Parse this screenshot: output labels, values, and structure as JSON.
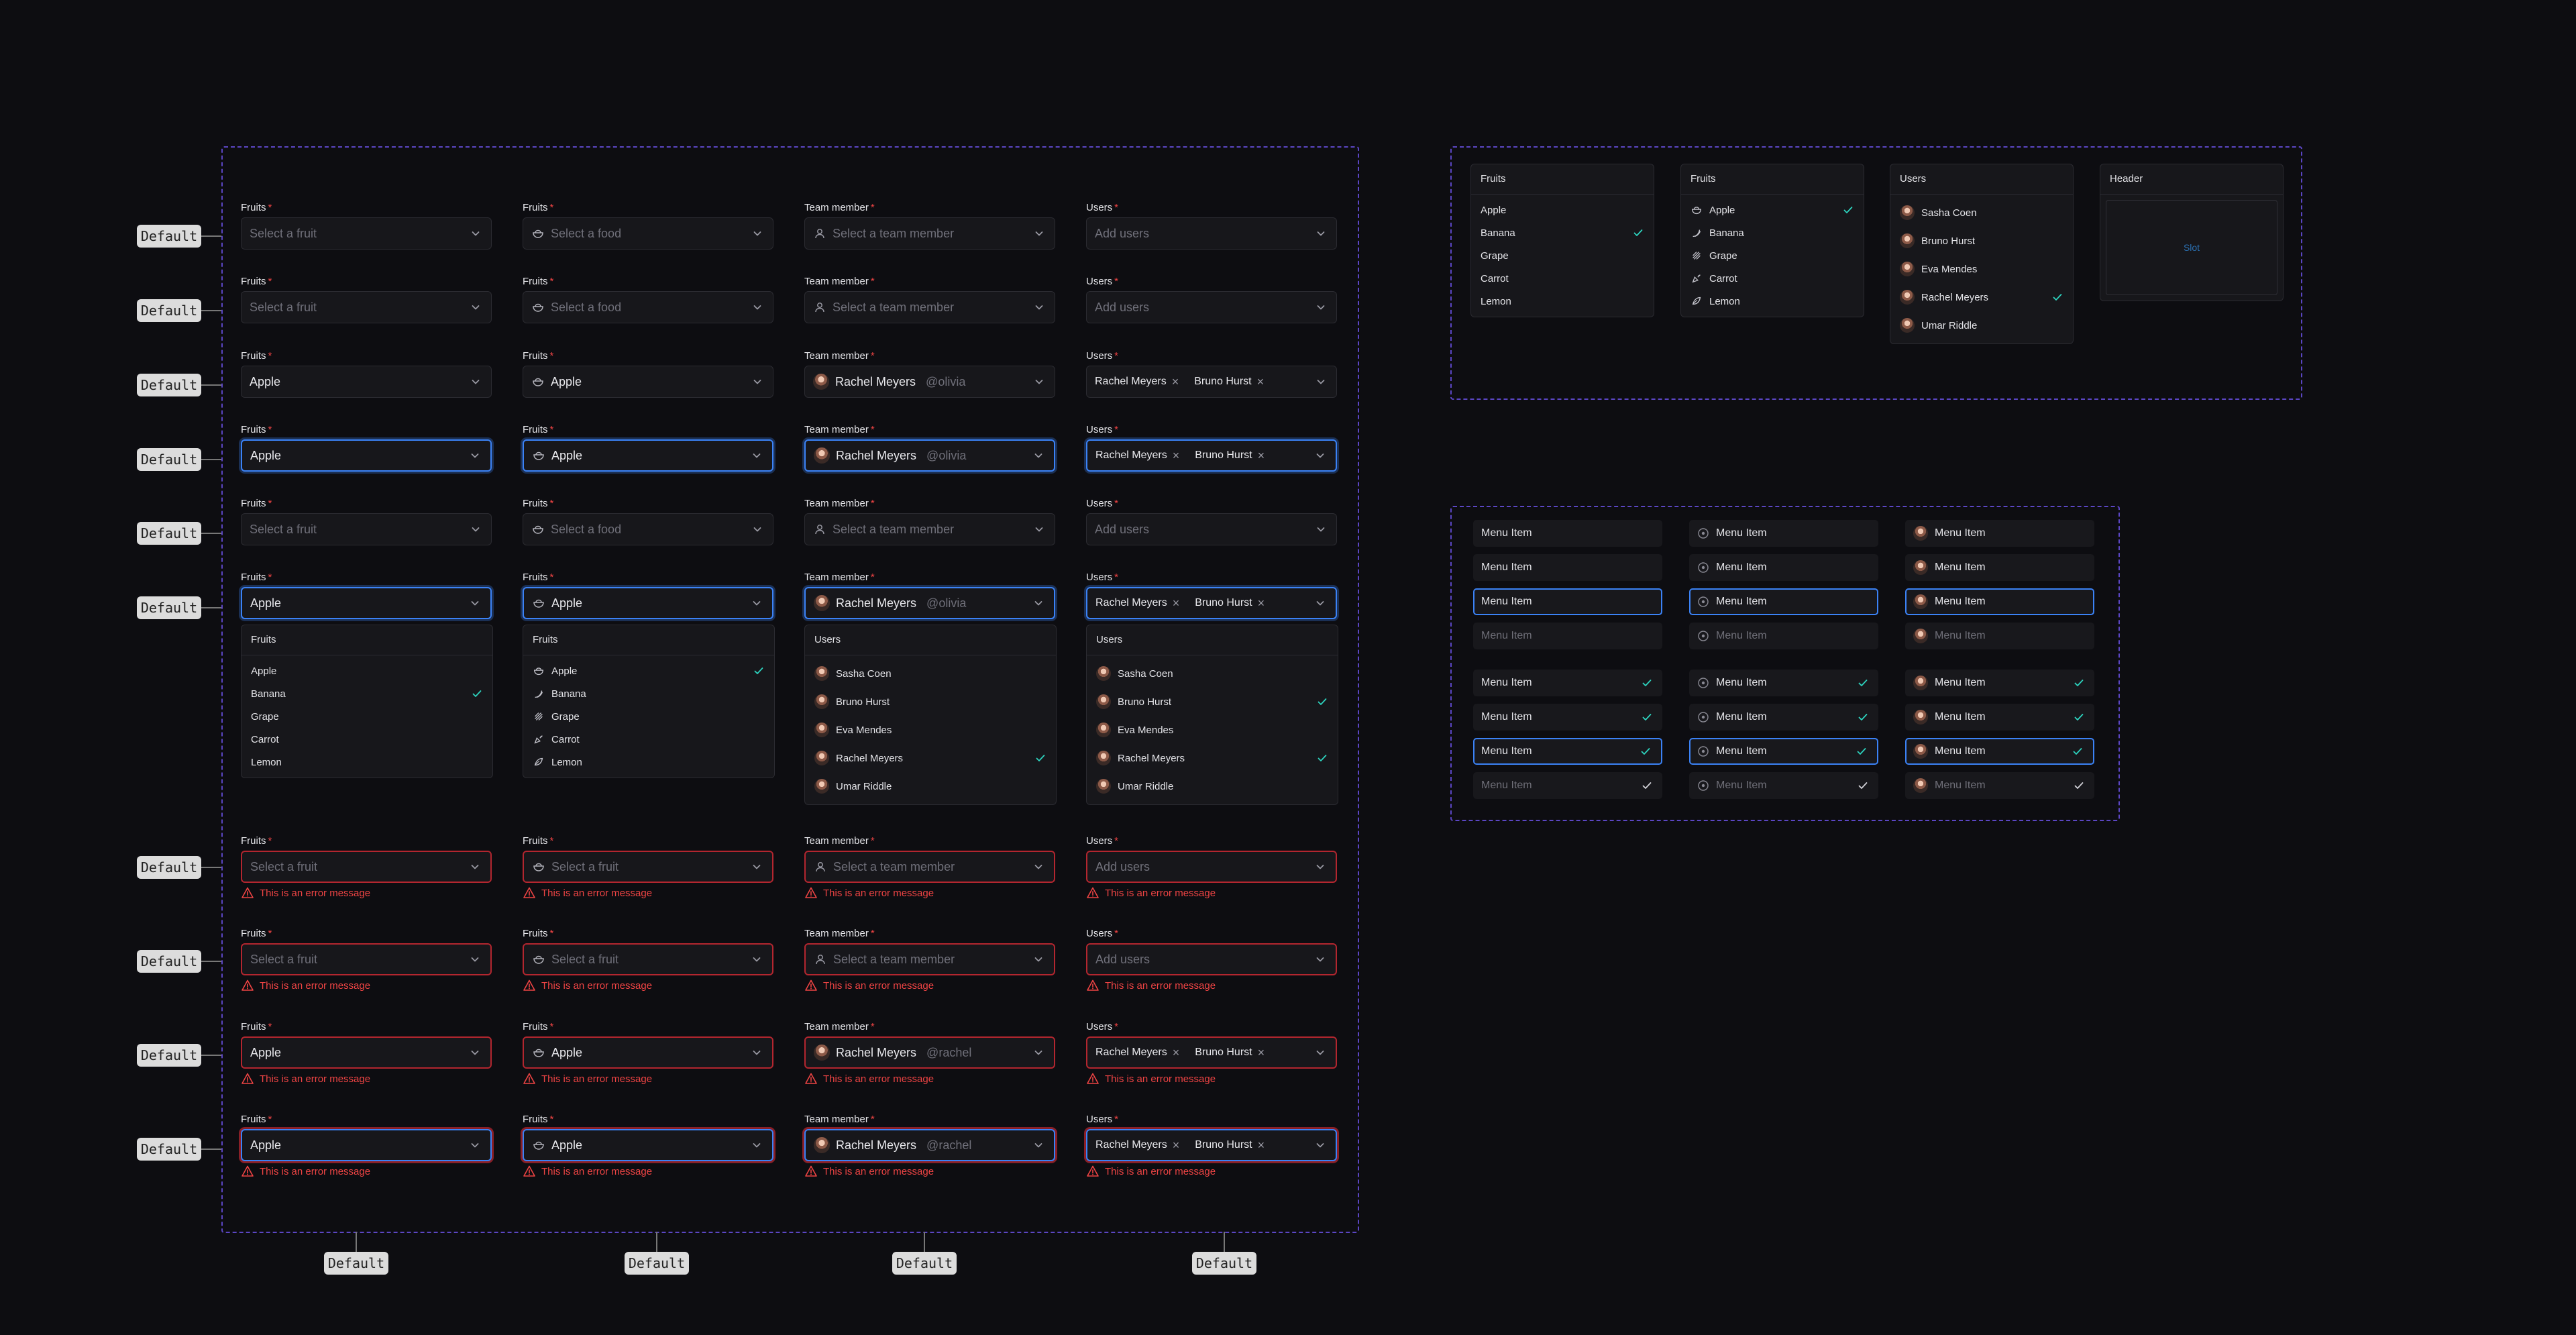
{
  "tag": "Default",
  "labels": {
    "fruits": "Fruits",
    "team": "Team member",
    "users": "Users"
  },
  "placeholders": {
    "fruit": "Select a fruit",
    "food": "Select a food",
    "team": "Select a team member",
    "users": "Add users"
  },
  "values": {
    "apple": "Apple",
    "rachel": "Rachel Meyers",
    "handle_olivia": "@olivia",
    "handle_rachel": "@rachel",
    "bruno": "Bruno Hurst"
  },
  "error_message": "This is an error message",
  "dropdown_fruits": {
    "header": "Fruits",
    "items": [
      "Apple",
      "Banana",
      "Grape",
      "Carrot",
      "Lemon"
    ]
  },
  "dropdown_users": {
    "header": "Users",
    "items": [
      "Sasha Coen",
      "Bruno Hurst",
      "Eva Mendes",
      "Rachel Meyers",
      "Umar Riddle"
    ]
  },
  "slot_panel": {
    "header": "Header",
    "slot": "Slot"
  },
  "menu_item_label": "Menu Item",
  "colors": {
    "accent": "#3b82f6",
    "error": "#ef4444",
    "check": "#2dd4bf",
    "frame": "#5b46c4"
  }
}
